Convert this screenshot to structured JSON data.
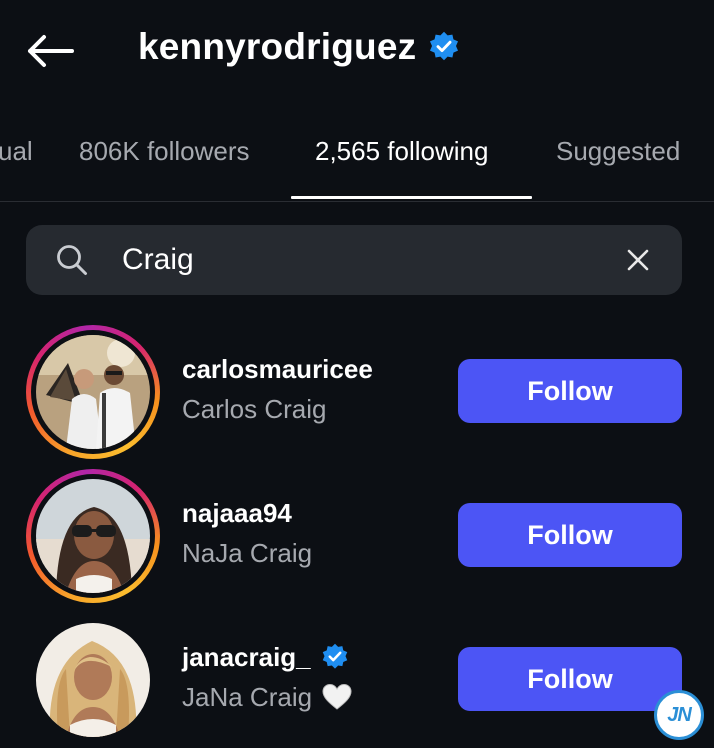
{
  "header": {
    "title": "kennyrodriguez",
    "verified": true
  },
  "tabs": [
    {
      "label": "ual",
      "active": false
    },
    {
      "label": "806K followers",
      "active": false
    },
    {
      "label": "2,565 following",
      "active": true
    },
    {
      "label": "Suggested",
      "active": false
    }
  ],
  "search": {
    "value": "Craig",
    "icon": "search-icon",
    "clear_icon": "close-icon"
  },
  "results": [
    {
      "username": "carlosmauricee",
      "fullname": "Carlos Craig",
      "verified": false,
      "story_ring": true,
      "button": "Follow"
    },
    {
      "username": "najaaa94",
      "fullname": "NaJa Craig",
      "verified": false,
      "story_ring": true,
      "button": "Follow"
    },
    {
      "username": "janacraig_",
      "fullname": "JaNa Craig",
      "verified": true,
      "story_ring": false,
      "button": "Follow",
      "emoji": "white-heart"
    }
  ],
  "watermark": {
    "text": "JN"
  },
  "colors": {
    "background": "#0c0f14",
    "follow_button": "#4c55f5",
    "verified_badge": "#1f8ef1",
    "secondary_text": "#a6a9af",
    "search_bg": "#262a30"
  }
}
